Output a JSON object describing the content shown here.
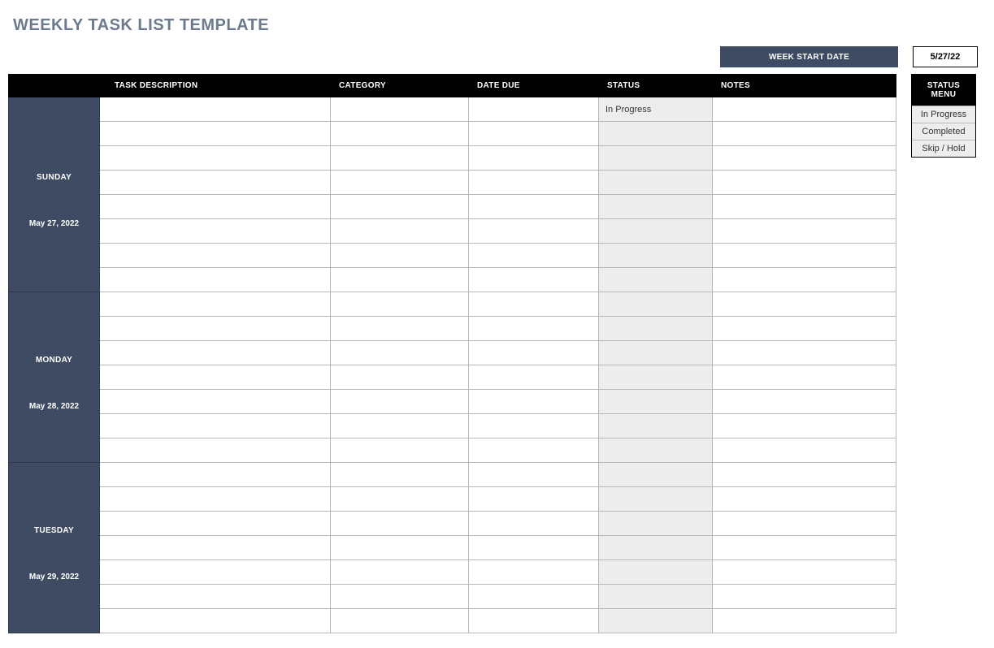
{
  "title": "WEEKLY TASK LIST TEMPLATE",
  "week_start": {
    "label": "WEEK START DATE",
    "value": "5/27/22"
  },
  "columns": {
    "task": "TASK DESCRIPTION",
    "category": "CATEGORY",
    "date_due": "DATE DUE",
    "status": "STATUS",
    "notes": "NOTES"
  },
  "days": [
    {
      "name": "SUNDAY",
      "date": "May 27, 2022",
      "rows": [
        {
          "task": "",
          "category": "",
          "date_due": "",
          "status": "In Progress",
          "notes": ""
        },
        {
          "task": "",
          "category": "",
          "date_due": "",
          "status": "",
          "notes": ""
        },
        {
          "task": "",
          "category": "",
          "date_due": "",
          "status": "",
          "notes": ""
        },
        {
          "task": "",
          "category": "",
          "date_due": "",
          "status": "",
          "notes": ""
        },
        {
          "task": "",
          "category": "",
          "date_due": "",
          "status": "",
          "notes": ""
        },
        {
          "task": "",
          "category": "",
          "date_due": "",
          "status": "",
          "notes": ""
        },
        {
          "task": "",
          "category": "",
          "date_due": "",
          "status": "",
          "notes": ""
        },
        {
          "task": "",
          "category": "",
          "date_due": "",
          "status": "",
          "notes": ""
        }
      ]
    },
    {
      "name": "MONDAY",
      "date": "May 28, 2022",
      "rows": [
        {
          "task": "",
          "category": "",
          "date_due": "",
          "status": "",
          "notes": ""
        },
        {
          "task": "",
          "category": "",
          "date_due": "",
          "status": "",
          "notes": ""
        },
        {
          "task": "",
          "category": "",
          "date_due": "",
          "status": "",
          "notes": ""
        },
        {
          "task": "",
          "category": "",
          "date_due": "",
          "status": "",
          "notes": ""
        },
        {
          "task": "",
          "category": "",
          "date_due": "",
          "status": "",
          "notes": ""
        },
        {
          "task": "",
          "category": "",
          "date_due": "",
          "status": "",
          "notes": ""
        },
        {
          "task": "",
          "category": "",
          "date_due": "",
          "status": "",
          "notes": ""
        }
      ]
    },
    {
      "name": "TUESDAY",
      "date": "May 29, 2022",
      "rows": [
        {
          "task": "",
          "category": "",
          "date_due": "",
          "status": "",
          "notes": ""
        },
        {
          "task": "",
          "category": "",
          "date_due": "",
          "status": "",
          "notes": ""
        },
        {
          "task": "",
          "category": "",
          "date_due": "",
          "status": "",
          "notes": ""
        },
        {
          "task": "",
          "category": "",
          "date_due": "",
          "status": "",
          "notes": ""
        },
        {
          "task": "",
          "category": "",
          "date_due": "",
          "status": "",
          "notes": ""
        },
        {
          "task": "",
          "category": "",
          "date_due": "",
          "status": "",
          "notes": ""
        },
        {
          "task": "",
          "category": "",
          "date_due": "",
          "status": "",
          "notes": ""
        }
      ]
    }
  ],
  "status_menu": {
    "header": "STATUS MENU",
    "items": [
      "In Progress",
      "Completed",
      "Skip / Hold"
    ]
  }
}
